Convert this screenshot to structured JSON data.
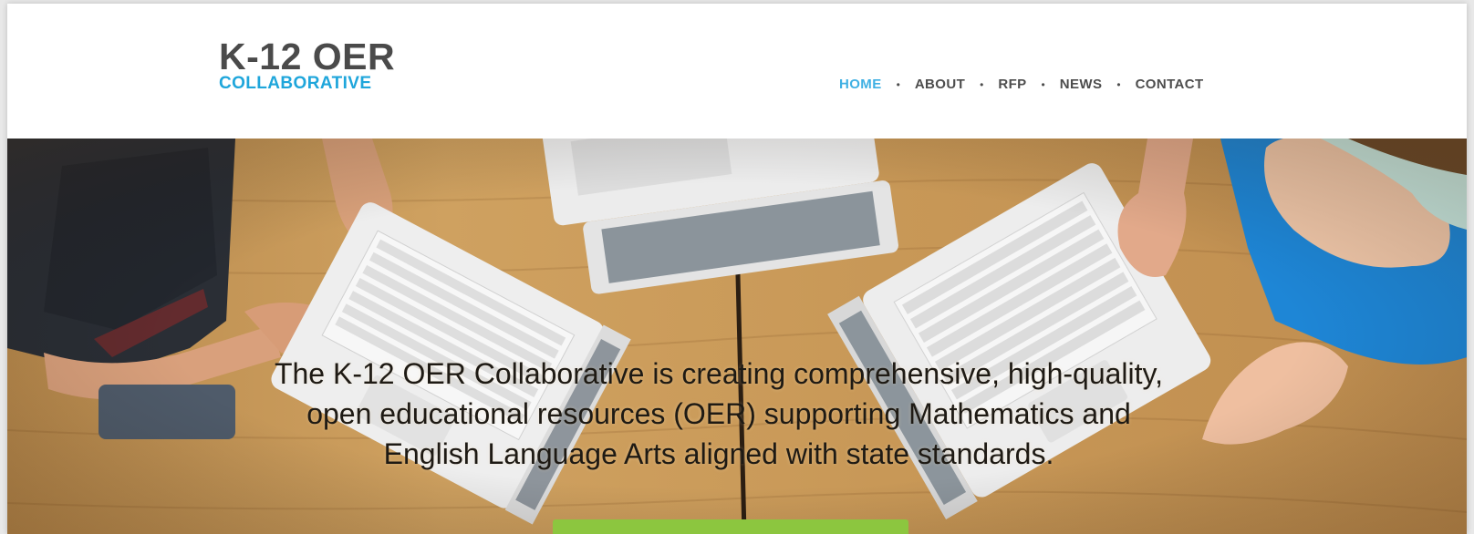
{
  "logo": {
    "line1": "K-12 OER",
    "line2": "COLLABORATIVE"
  },
  "nav": {
    "items": [
      {
        "label": "HOME",
        "active": true
      },
      {
        "label": "ABOUT",
        "active": false
      },
      {
        "label": "RFP",
        "active": false
      },
      {
        "label": "NEWS",
        "active": false
      },
      {
        "label": "CONTACT",
        "active": false
      }
    ],
    "separator": "•"
  },
  "hero": {
    "line1": "The K-12 OER Collaborative is creating comprehensive, high-quality,",
    "line2": "open educational resources (OER) supporting Mathematics and",
    "line3": "English Language Arts aligned with state standards."
  },
  "colors": {
    "brand_dark": "#4a4a4a",
    "brand_blue": "#1fa6db",
    "nav_active": "#3fb0e3",
    "cta_green": "#8cc63f"
  },
  "icons": [
    "laptop-illustration"
  ]
}
